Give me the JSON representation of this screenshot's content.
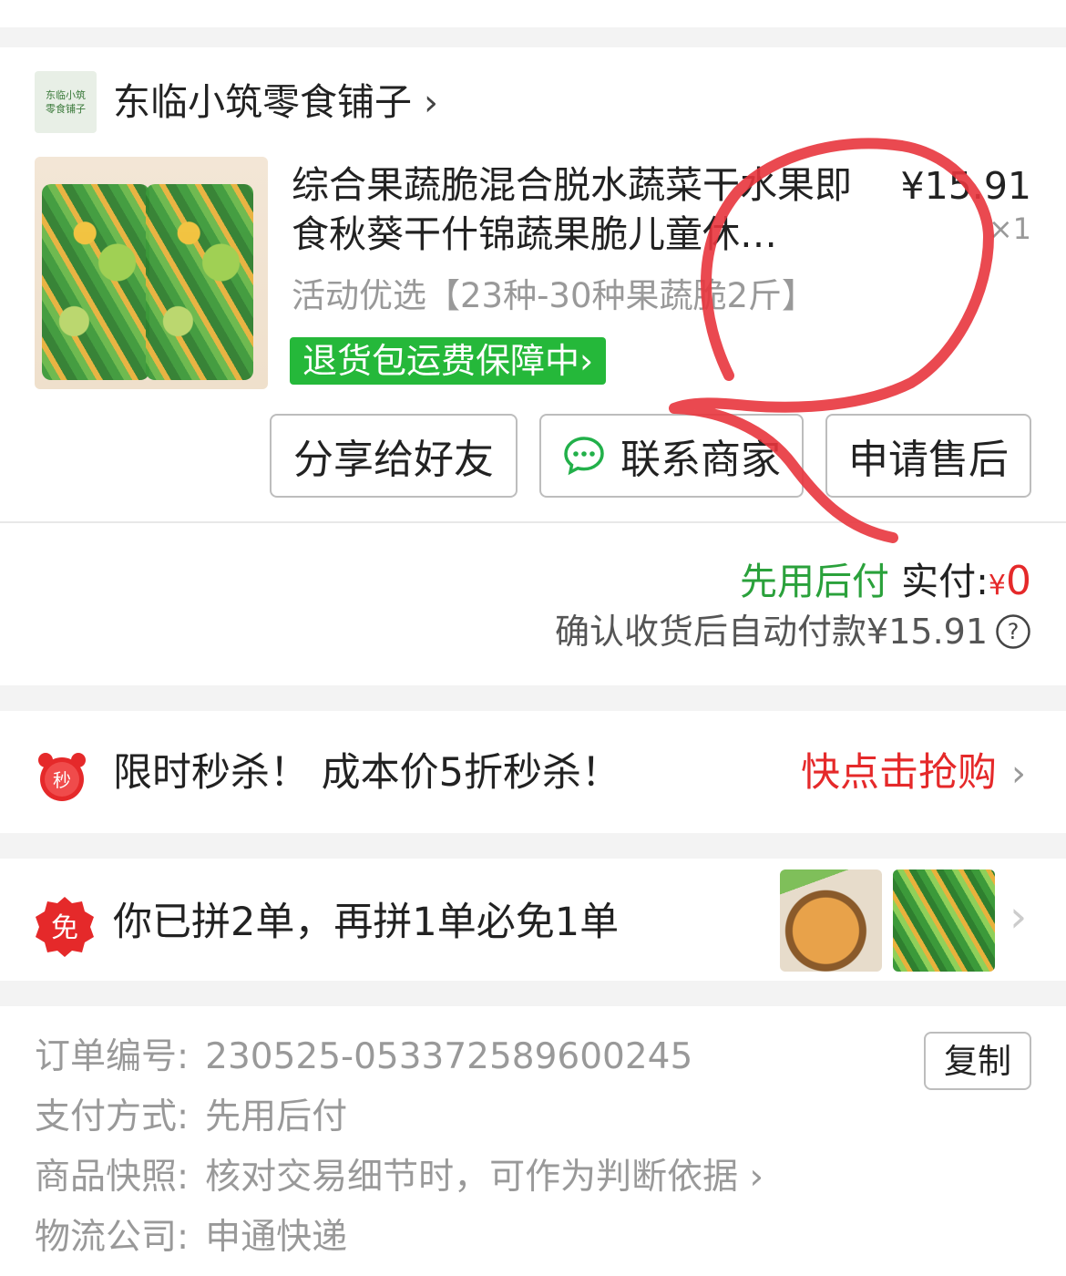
{
  "shop": {
    "logo_text": "东临小筑零食铺子",
    "name": "东临小筑零食铺子",
    "chevron": "›"
  },
  "product": {
    "title": "综合果蔬脆混合脱水蔬菜干水果即食秋葵干什锦蔬果脆儿童休…",
    "price": "¥15.91",
    "qty": "×1",
    "spec": "活动优选【23种-30种果蔬脆2斤】",
    "return_badge": "退货包运费保障中›"
  },
  "actions": {
    "share": "分享给好友",
    "contact": "联系商家",
    "after_sale": "申请售后"
  },
  "payment": {
    "label": "先用后付",
    "paid_label": "实付:",
    "yen": "¥",
    "amount": "0",
    "auto_pay": "确认收货后自动付款¥15.91",
    "help_icon": "?"
  },
  "seckill": {
    "icon_text": "秒",
    "text": "限时秒杀！ 成本价5折秒杀！",
    "cta": "快点击抢购",
    "chevron": "›"
  },
  "group": {
    "icon_text": "免",
    "text": "你已拼2单，再拼1单必免1单",
    "chevron": "›"
  },
  "order_info": {
    "rows": [
      {
        "label": "订单编号:",
        "value": "230525-053372589600245"
      },
      {
        "label": "支付方式:",
        "value": "先用后付"
      },
      {
        "label": "商品快照:",
        "value": "核对交易细节时，可作为判断依据 ›"
      },
      {
        "label": "物流公司:",
        "value": "申通快递"
      }
    ],
    "copy": "复制"
  },
  "colors": {
    "green": "#25b83a",
    "red": "#e5292a",
    "annotation": "#e8353d"
  }
}
